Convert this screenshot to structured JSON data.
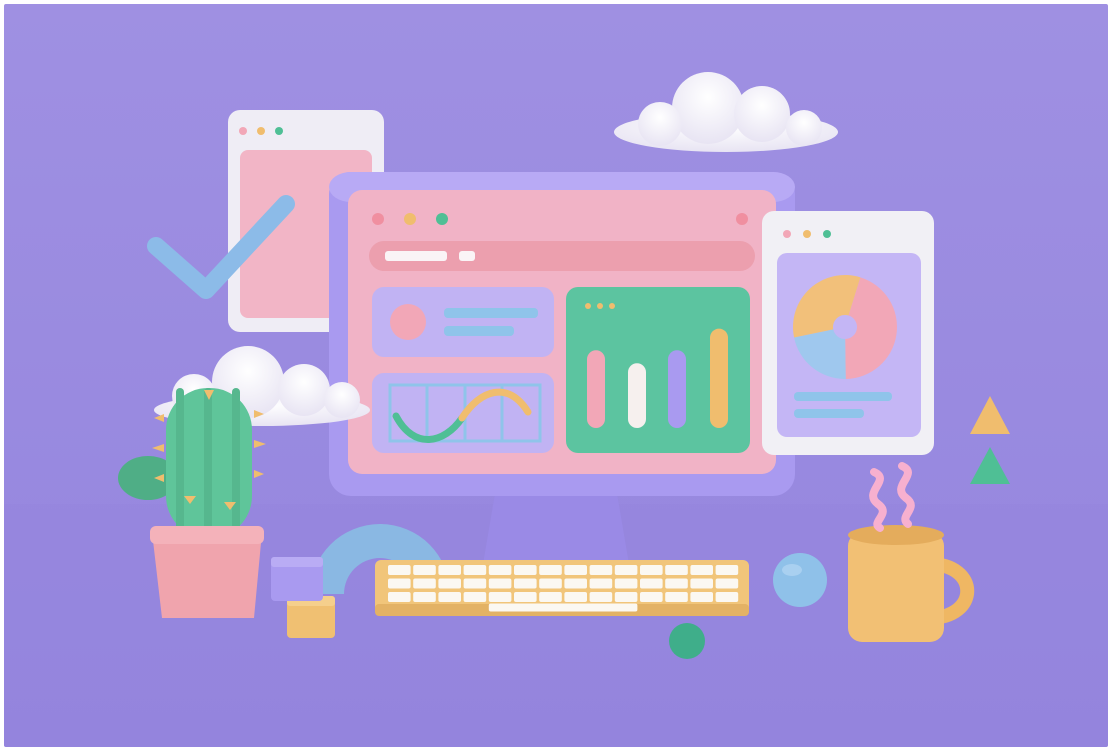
{
  "scene": {
    "colors": {
      "background": "#9d8ee0",
      "floor": "#9484dc",
      "monitor_frame": "#a99af0",
      "monitor_stand": "#9a8ae6",
      "screen": "#f1b3c6",
      "screen_top": "#f6c3d2",
      "address_bar": "#ec9fae",
      "card_lavender": "#c4b6f5",
      "card_green": "#5cc4a0",
      "accent_pink": "#f2a7b7",
      "accent_yellow": "#f0bd6e",
      "accent_green": "#4fbf95",
      "accent_blue": "#8fc4ea",
      "cloud": "#f6f4fb",
      "window_white": "#f1f0f5",
      "keyboard_base": "#f1c57a",
      "key": "#fbf8f2",
      "cactus": "#5fc59a",
      "pot": "#f0a4ad",
      "mug": "#f2c074",
      "ball_blue": "#8fc1e9",
      "ball_green": "#3fae8a",
      "steam": "#f7b0cf",
      "arch": "#8ab8e3",
      "cube_lavender": "#a99af0",
      "cube_yellow": "#f0c072"
    },
    "icons": [
      "checkmark-icon",
      "donut-chart-icon",
      "bar-chart-icon",
      "wave-chart-icon",
      "triangle-icon",
      "cloud-icon"
    ],
    "bar_chart_levels": [
      0.72,
      0.6,
      0.72,
      0.92
    ],
    "donut_slices": [
      {
        "name": "pink",
        "fraction": 0.45,
        "color": "#f2a7b7"
      },
      {
        "name": "blue",
        "fraction": 0.22,
        "color": "#9fc8ee"
      },
      {
        "name": "yellow",
        "fraction": 0.33,
        "color": "#f2c07a"
      }
    ]
  }
}
